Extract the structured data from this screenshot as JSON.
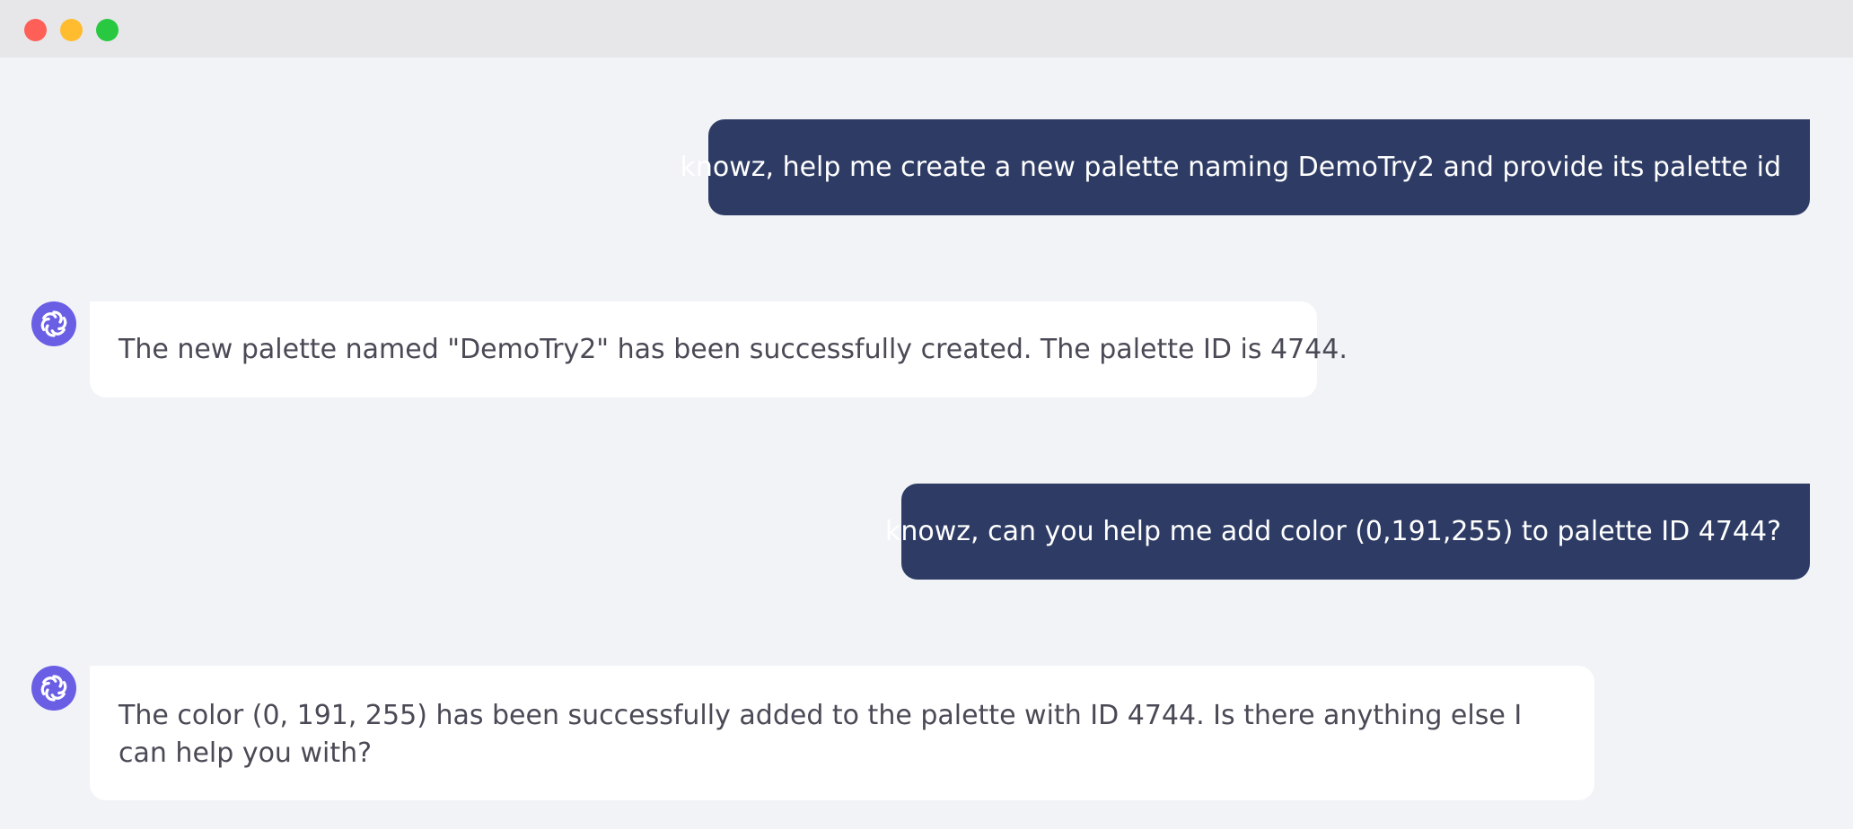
{
  "window": {
    "controls": [
      "close",
      "minimize",
      "maximize"
    ],
    "colors": {
      "close": "#fe5f57",
      "minimize": "#febc2e",
      "maximize": "#28c840"
    }
  },
  "theme": {
    "user_bubble": "#2e3c65",
    "bot_bubble": "#ffffff",
    "avatar": "#6a5ee5",
    "background": "#f2f3f7"
  },
  "messages": [
    {
      "role": "user",
      "text": "knowz, help me create a new palette naming DemoTry2 and provide its palette id"
    },
    {
      "role": "assistant",
      "avatar_icon": "assistant-logo-icon",
      "text": "The new palette named \"DemoTry2\" has been successfully created. The palette ID is 4744."
    },
    {
      "role": "user",
      "text": "knowz, can you help me add color (0,191,255) to palette ID 4744?"
    },
    {
      "role": "assistant",
      "avatar_icon": "assistant-logo-icon",
      "text": "The color (0, 191, 255) has been successfully added to the palette with ID 4744. Is there anything else I can help you with?"
    }
  ]
}
